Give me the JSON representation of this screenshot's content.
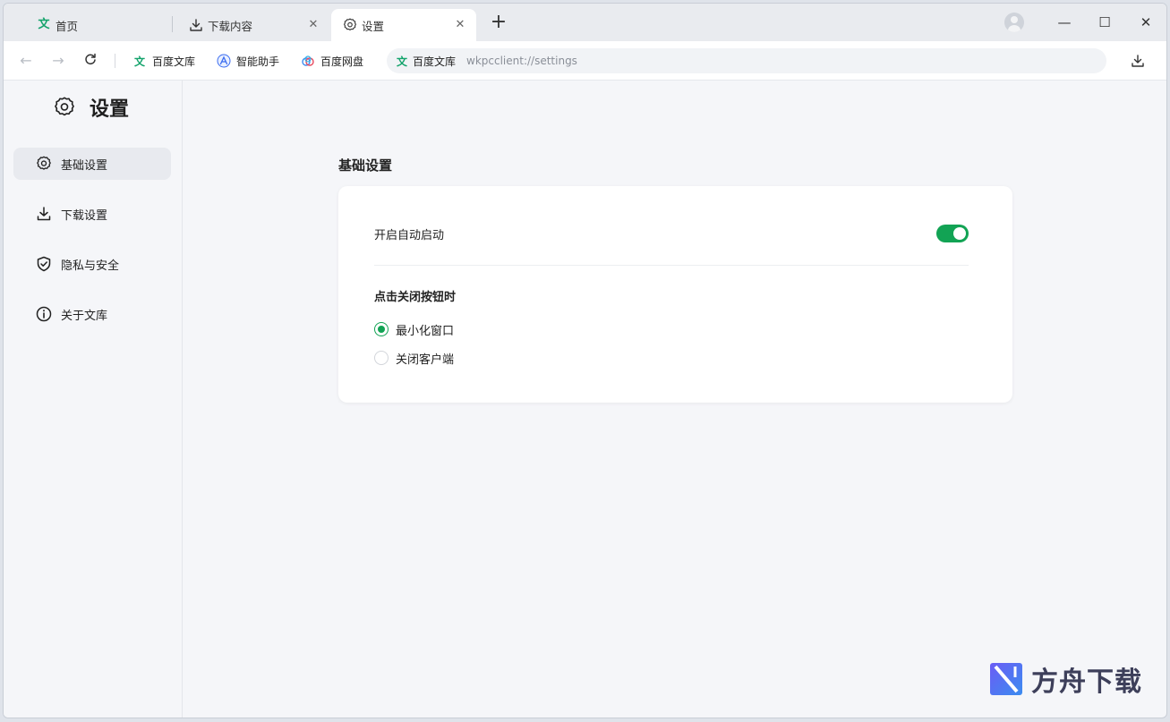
{
  "tabs": [
    {
      "label": "首页",
      "icon": "wenku-logo-icon"
    },
    {
      "label": "下载内容",
      "icon": "download-icon"
    },
    {
      "label": "设置",
      "icon": "gear-icon"
    }
  ],
  "addressbar": {
    "bookmarks": [
      {
        "label": "百度文库",
        "icon": "wenku-logo-icon"
      },
      {
        "label": "智能助手",
        "icon": "assistant-icon"
      },
      {
        "label": "百度网盘",
        "icon": "netdisk-icon"
      }
    ],
    "site_label": "百度文库",
    "url": "wkpcclient://settings"
  },
  "sidebar": {
    "title": "设置",
    "items": [
      {
        "label": "基础设置",
        "icon": "gear-icon",
        "active": true
      },
      {
        "label": "下载设置",
        "icon": "download-icon"
      },
      {
        "label": "隐私与安全",
        "icon": "shield-icon"
      },
      {
        "label": "关于文库",
        "icon": "info-icon"
      }
    ]
  },
  "main": {
    "section_title": "基础设置",
    "autostart": {
      "label": "开启自动启动",
      "enabled": true
    },
    "close_behavior": {
      "title": "点击关闭按钮时",
      "options": [
        {
          "label": "最小化窗口",
          "selected": true
        },
        {
          "label": "关闭客户端",
          "selected": false
        }
      ]
    }
  },
  "watermark": {
    "text": "方舟下载"
  },
  "colors": {
    "accent": "#12a354",
    "wenku_green": "#13a36b"
  }
}
